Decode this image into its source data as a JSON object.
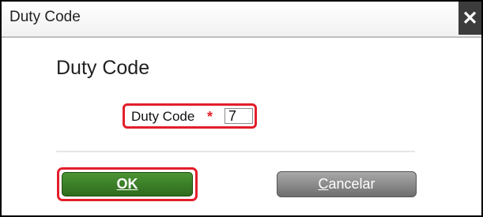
{
  "dialog": {
    "title": "Duty Code",
    "close_icon": "close-icon",
    "close_glyph": "✕"
  },
  "form": {
    "heading": "Duty Code",
    "field_label": "Duty Code",
    "required_marker": "*",
    "field_value": "7"
  },
  "buttons": {
    "ok_label": "OK",
    "cancel_first_letter": "C",
    "cancel_rest": "ancelar"
  },
  "colors": {
    "highlight": "#e31e2a",
    "ok_button": "#3d7f28",
    "cancel_button": "#8c8c8c",
    "close_button": "#3c3c3c"
  }
}
